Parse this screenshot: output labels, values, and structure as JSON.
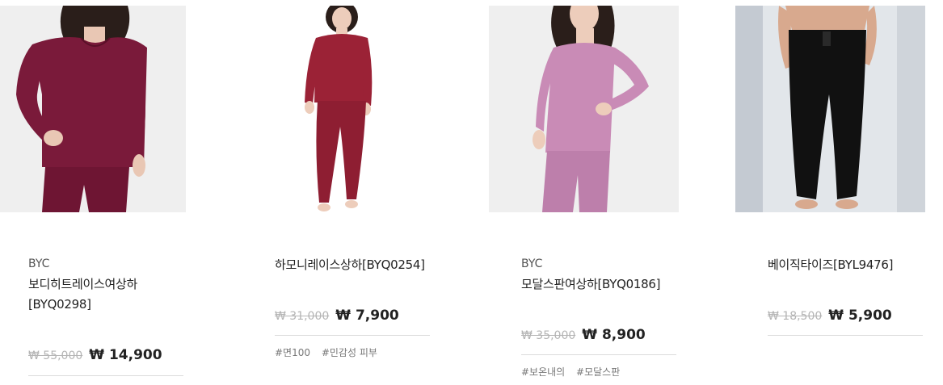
{
  "products": [
    {
      "brand": "BYC",
      "name_line1": "보디히트레이스여상하",
      "name_line2": "[BYQ0298]",
      "original_price": "₩ 55,000",
      "sale_price": "₩ 14,900",
      "tags": [],
      "garment_color": "#7a1a3a",
      "bg_color": "#eeeeee"
    },
    {
      "brand": "",
      "name_line1": "하모니레이스상하[BYQ0254]",
      "name_line2": "",
      "original_price": "₩ 31,000",
      "sale_price": "₩ 7,900",
      "tags": [
        "#면100",
        "#민감성 피부"
      ],
      "garment_color": "#9b2236",
      "bg_color": "#ffffff"
    },
    {
      "brand": "BYC",
      "name_line1": "모달스판여상하[BYQ0186]",
      "name_line2": "",
      "original_price": "₩ 35,000",
      "sale_price": "₩ 8,900",
      "tags": [
        "#보온내의",
        "#모달스판"
      ],
      "garment_color": "#c98bb6",
      "bg_color": "#eeeeee"
    },
    {
      "brand": "",
      "name_line1": "베이직타이즈[BYL9476]",
      "name_line2": "",
      "original_price": "₩ 18,500",
      "sale_price": "₩ 5,900",
      "tags": [],
      "garment_color": "#111111",
      "bg_color": "#dfe3e8"
    }
  ]
}
